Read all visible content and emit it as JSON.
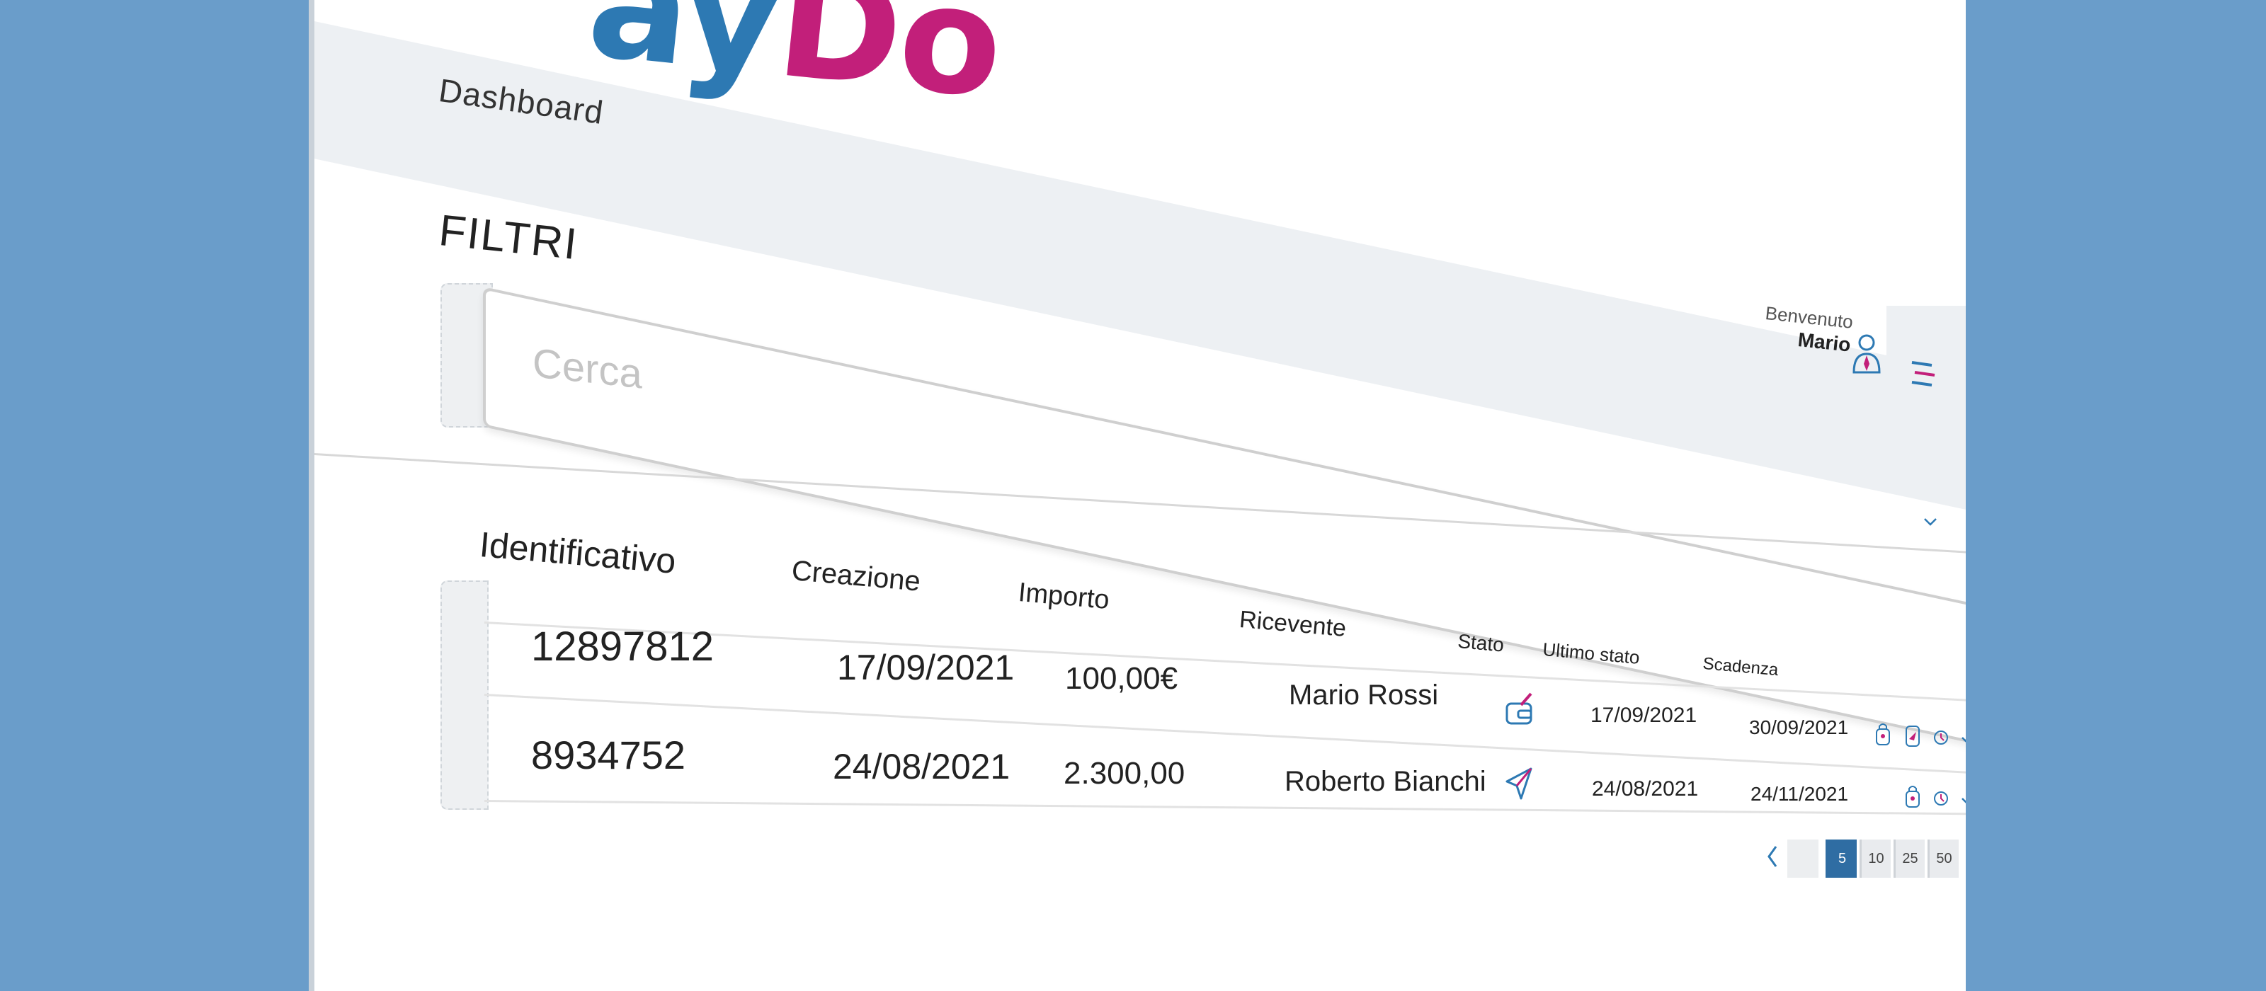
{
  "app": {
    "logo_part1": "ay",
    "logo_part2": "Do",
    "brand_blue": "#2d79b3",
    "brand_magenta": "#c21f7a"
  },
  "nav": {
    "current_page": "Dashboard"
  },
  "user": {
    "welcome": "Benvenuto",
    "name": "Mario",
    "icon": "user-icon",
    "menu_icon": "hamburger-menu-icon"
  },
  "filters": {
    "title": "FILTRI",
    "search_placeholder": "Cerca",
    "toggle_icon": "chevron-down-icon"
  },
  "table": {
    "headers": {
      "id": "Identificativo",
      "created": "Creazione",
      "amount": "Importo",
      "recipient": "Ricevente",
      "status": "Stato",
      "last_status": "Ultimo stato",
      "due": "Scadenza"
    },
    "rows": [
      {
        "id": "12897812",
        "created": "17/09/2021",
        "amount": "100,00€",
        "recipient": "Mario Rossi",
        "status_icon": "wallet-edit-icon",
        "last_status": "17/09/2021",
        "due": "30/09/2021",
        "actions": [
          "lock-icon",
          "send-icon",
          "reset-icon"
        ]
      },
      {
        "id": "8934752",
        "created": "24/08/2021",
        "amount": "2.300,00",
        "recipient": "Roberto Bianchi",
        "status_icon": "paper-plane-icon",
        "last_status": "24/08/2021",
        "due": "24/11/2021",
        "actions": [
          "lock-icon",
          "reset-icon"
        ]
      }
    ]
  },
  "pagination": {
    "page_sizes": [
      "5",
      "10",
      "25",
      "50"
    ],
    "selected_page_size": "5",
    "accent": "#2f6da3"
  }
}
